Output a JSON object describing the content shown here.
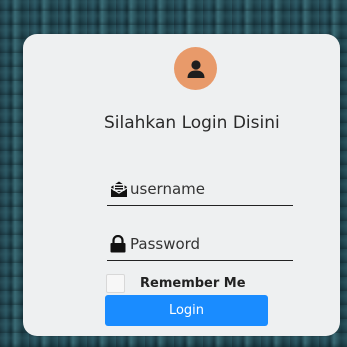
{
  "login_card": {
    "avatar_icon": "user-icon",
    "title": "Silahkan Login Disini",
    "username": {
      "icon": "envelope-open-icon",
      "placeholder": "username",
      "value": ""
    },
    "password": {
      "icon": "lock-icon",
      "placeholder": "Password",
      "value": ""
    },
    "remember_label": "Remember Me",
    "remember_checked": false,
    "login_label": "Login"
  },
  "colors": {
    "card_background": "#eef0f1",
    "avatar_background": "#e89a6a",
    "login_button": "#1a8cff"
  }
}
